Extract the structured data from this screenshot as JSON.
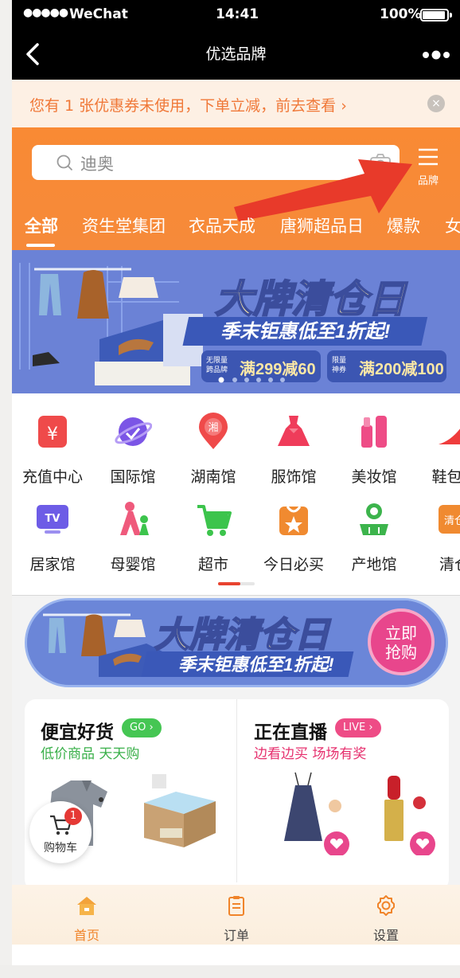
{
  "status": {
    "signal": "●●●●●",
    "carrier": "WeChat",
    "time": "14:41",
    "battery": "100%"
  },
  "nav": {
    "title": "优选品牌",
    "back_icon": "chevron-left-icon",
    "more_icon": "more-dots-icon"
  },
  "coupon": {
    "text": "您有 1 张优惠券未使用，下单立减，前去查看 ›",
    "close": "×"
  },
  "search": {
    "text": "迪奥",
    "icon": "search-icon",
    "camera_icon": "camera-icon"
  },
  "brand_menu": {
    "label": "品牌",
    "icon": "menu-lines-icon"
  },
  "tabs": [
    {
      "label": "全部",
      "active": true
    },
    {
      "label": "资生堂集团"
    },
    {
      "label": "衣品天成"
    },
    {
      "label": "唐狮超品日"
    },
    {
      "label": "爆款"
    },
    {
      "label": "女"
    }
  ],
  "banner": {
    "title": "大牌清仓日",
    "subtitle": "季末钜惠低至1折起!",
    "tag1_small_a": "无限量",
    "tag1_small_b": "跨品牌",
    "tag1": "满299减60",
    "tag2_small_a": "限量",
    "tag2_small_b": "神券",
    "tag2": "满200减100"
  },
  "categories": [
    {
      "label": "充值中心",
      "icon": "recharge-icon",
      "color": "#ef4a4a"
    },
    {
      "label": "国际馆",
      "icon": "planet-icon",
      "color": "#7b55e6"
    },
    {
      "label": "湖南馆",
      "icon": "map-pin-icon",
      "color": "#ef4a4a",
      "glyph": "湘"
    },
    {
      "label": "服饰馆",
      "icon": "dress-icon",
      "color": "#ef3c5a"
    },
    {
      "label": "美妆馆",
      "icon": "cosmetics-icon",
      "color": "#ee4c86"
    },
    {
      "label": "鞋包配",
      "icon": "high-heel-icon",
      "color": "#ef3c3c"
    },
    {
      "label": "居家馆",
      "icon": "tv-icon",
      "color": "#6d5ce6",
      "glyph": "TV"
    },
    {
      "label": "母婴馆",
      "icon": "mother-baby-icon",
      "color": "#ef5a7c"
    },
    {
      "label": "超市",
      "icon": "shopping-cart-icon",
      "color": "#3cc44c"
    },
    {
      "label": "今日必买",
      "icon": "star-bag-icon",
      "color": "#f08a30"
    },
    {
      "label": "产地馆",
      "icon": "farmer-icon",
      "color": "#3cb44c"
    },
    {
      "label": "清仓",
      "icon": "clearance-icon",
      "color": "#f08a30",
      "glyph": "清仓"
    }
  ],
  "pill_banner": {
    "title": "大牌清仓日",
    "subtitle": "季末钜惠低至1折起!",
    "cta_a": "立即",
    "cta_b": "抢购"
  },
  "cards": [
    {
      "title": "便宜好货",
      "badge": "GO ›",
      "badge_color": "#45c653",
      "subtitle": "低价商品 天天购",
      "sub_color": "#3ab04a"
    },
    {
      "title": "正在直播",
      "badge": "LIVE ›",
      "badge_color": "#ee4c86",
      "subtitle": "边看边买 场场有奖",
      "sub_color": "#e6306e"
    }
  ],
  "cart": {
    "label": "购物车",
    "count": "1",
    "icon": "cart-icon"
  },
  "bottom_tabs": [
    {
      "label": "首页",
      "icon": "home-icon",
      "active": true
    },
    {
      "label": "订单",
      "icon": "clipboard-icon"
    },
    {
      "label": "设置",
      "icon": "gear-icon"
    }
  ]
}
